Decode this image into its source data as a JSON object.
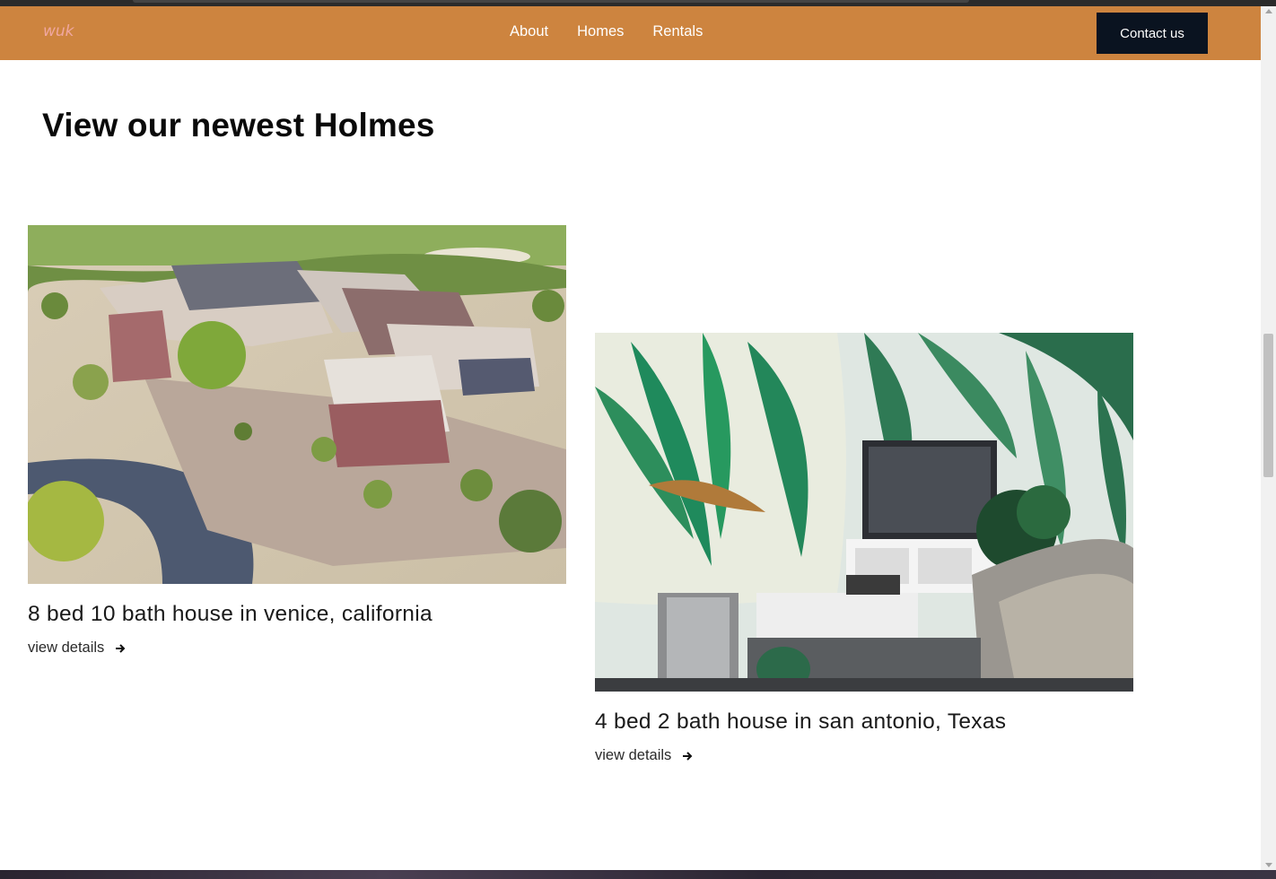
{
  "nav": {
    "logo": "wuk",
    "links": [
      "About",
      "Homes",
      "Rentals"
    ],
    "contact_label": "Contact us"
  },
  "section": {
    "title": "View our newest Holmes"
  },
  "listings": [
    {
      "title": "8 bed 10 bath house in venice, california",
      "link_label": "view details",
      "image": "aerial-desert-house-photo"
    },
    {
      "title": "4 bed 2 bath house in san antonio, Texas",
      "link_label": "view details",
      "image": "tropical-living-room-photo"
    }
  ],
  "colors": {
    "navbar": "#cd843f",
    "logo": "#f0a7a0",
    "contact_button": "#0a1320"
  }
}
